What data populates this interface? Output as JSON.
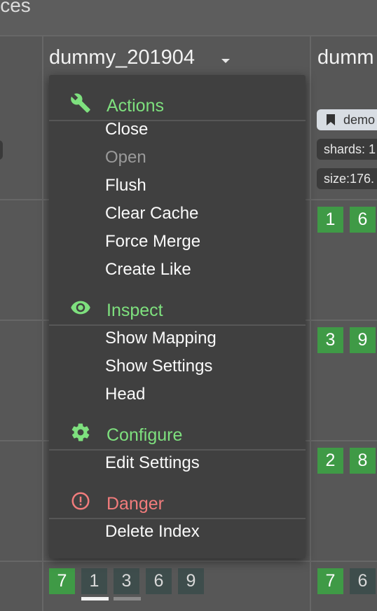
{
  "header": {
    "title_fragment": "ices"
  },
  "columns": [
    {
      "title": "dummy_201904"
    },
    {
      "title": "dumm"
    }
  ],
  "second_column": {
    "alias_badge": "demo",
    "shards_info": "shards: 1",
    "size_info": "size:176."
  },
  "shard_rows": [
    {
      "col2": [
        "1",
        "6"
      ]
    },
    {
      "col2": [
        "3",
        "9"
      ]
    },
    {
      "col2": [
        "2",
        "8"
      ]
    },
    {
      "col1": [
        "7",
        "1",
        "3",
        "6",
        "9"
      ],
      "col2": [
        "7",
        "6"
      ]
    }
  ],
  "menu": {
    "sections": [
      {
        "label": "Actions",
        "icon": "wrench-icon",
        "color": "#7ee07e",
        "items": [
          {
            "label": "Close",
            "enabled": true
          },
          {
            "label": "Open",
            "enabled": false
          },
          {
            "label": "Flush",
            "enabled": true
          },
          {
            "label": "Clear Cache",
            "enabled": true
          },
          {
            "label": "Force Merge",
            "enabled": true
          },
          {
            "label": "Create Like",
            "enabled": true
          }
        ]
      },
      {
        "label": "Inspect",
        "icon": "eye-icon",
        "color": "#7ee07e",
        "items": [
          {
            "label": "Show Mapping",
            "enabled": true
          },
          {
            "label": "Show Settings",
            "enabled": true
          },
          {
            "label": "Head",
            "enabled": true
          }
        ]
      },
      {
        "label": "Configure",
        "icon": "gear-icon",
        "color": "#7ee07e",
        "items": [
          {
            "label": "Edit Settings",
            "enabled": true
          }
        ]
      },
      {
        "label": "Danger",
        "icon": "alert-circle-icon",
        "color": "#f27c7c",
        "items": [
          {
            "label": "Delete Index",
            "enabled": true
          }
        ]
      }
    ]
  },
  "colors": {
    "started_shard": "#3f9a46",
    "replica_shard": "#3e4d4c",
    "menu_bg": "#404040"
  }
}
